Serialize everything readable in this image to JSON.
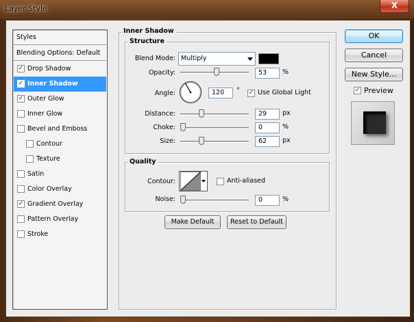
{
  "window": {
    "title": "Layer Style",
    "close_glyph": "X"
  },
  "styles_list": {
    "header": "Styles",
    "blending": "Blending Options: Default",
    "items": [
      {
        "label": "Drop Shadow",
        "checked": true
      },
      {
        "label": "Inner Shadow",
        "checked": true,
        "selected": true
      },
      {
        "label": "Outer Glow",
        "checked": true
      },
      {
        "label": "Inner Glow",
        "checked": false
      },
      {
        "label": "Bevel and Emboss",
        "checked": false
      },
      {
        "label": "Contour",
        "checked": false,
        "sub": true
      },
      {
        "label": "Texture",
        "checked": false,
        "sub": true
      },
      {
        "label": "Satin",
        "checked": false
      },
      {
        "label": "Color Overlay",
        "checked": false
      },
      {
        "label": "Gradient Overlay",
        "checked": true
      },
      {
        "label": "Pattern Overlay",
        "checked": false
      },
      {
        "label": "Stroke",
        "checked": false
      }
    ]
  },
  "panel": {
    "section_title": "Inner Shadow",
    "structure": {
      "title": "Structure",
      "blend_mode_label": "Blend Mode:",
      "blend_mode_value": "Multiply",
      "blend_color": "#000000",
      "opacity_label": "Opacity:",
      "opacity_value": "53",
      "opacity_unit": "%",
      "angle_label": "Angle:",
      "angle_value": "120",
      "angle_unit": "°",
      "use_global_light_label": "Use Global Light",
      "use_global_light_checked": true,
      "distance_label": "Distance:",
      "distance_value": "29",
      "distance_unit": "px",
      "choke_label": "Choke:",
      "choke_value": "0",
      "choke_unit": "%",
      "size_label": "Size:",
      "size_value": "62",
      "size_unit": "px"
    },
    "quality": {
      "title": "Quality",
      "contour_label": "Contour:",
      "anti_aliased_label": "Anti-aliased",
      "anti_aliased_checked": false,
      "noise_label": "Noise:",
      "noise_value": "0",
      "noise_unit": "%"
    },
    "make_default_label": "Make Default",
    "reset_default_label": "Reset to Default"
  },
  "right": {
    "ok_label": "OK",
    "cancel_label": "Cancel",
    "new_style_label": "New Style...",
    "preview_label": "Preview",
    "preview_checked": true
  },
  "colors": {
    "selection": "#3399ff",
    "dialog_bg": "#ececec"
  },
  "icons": {
    "check": "✓"
  }
}
